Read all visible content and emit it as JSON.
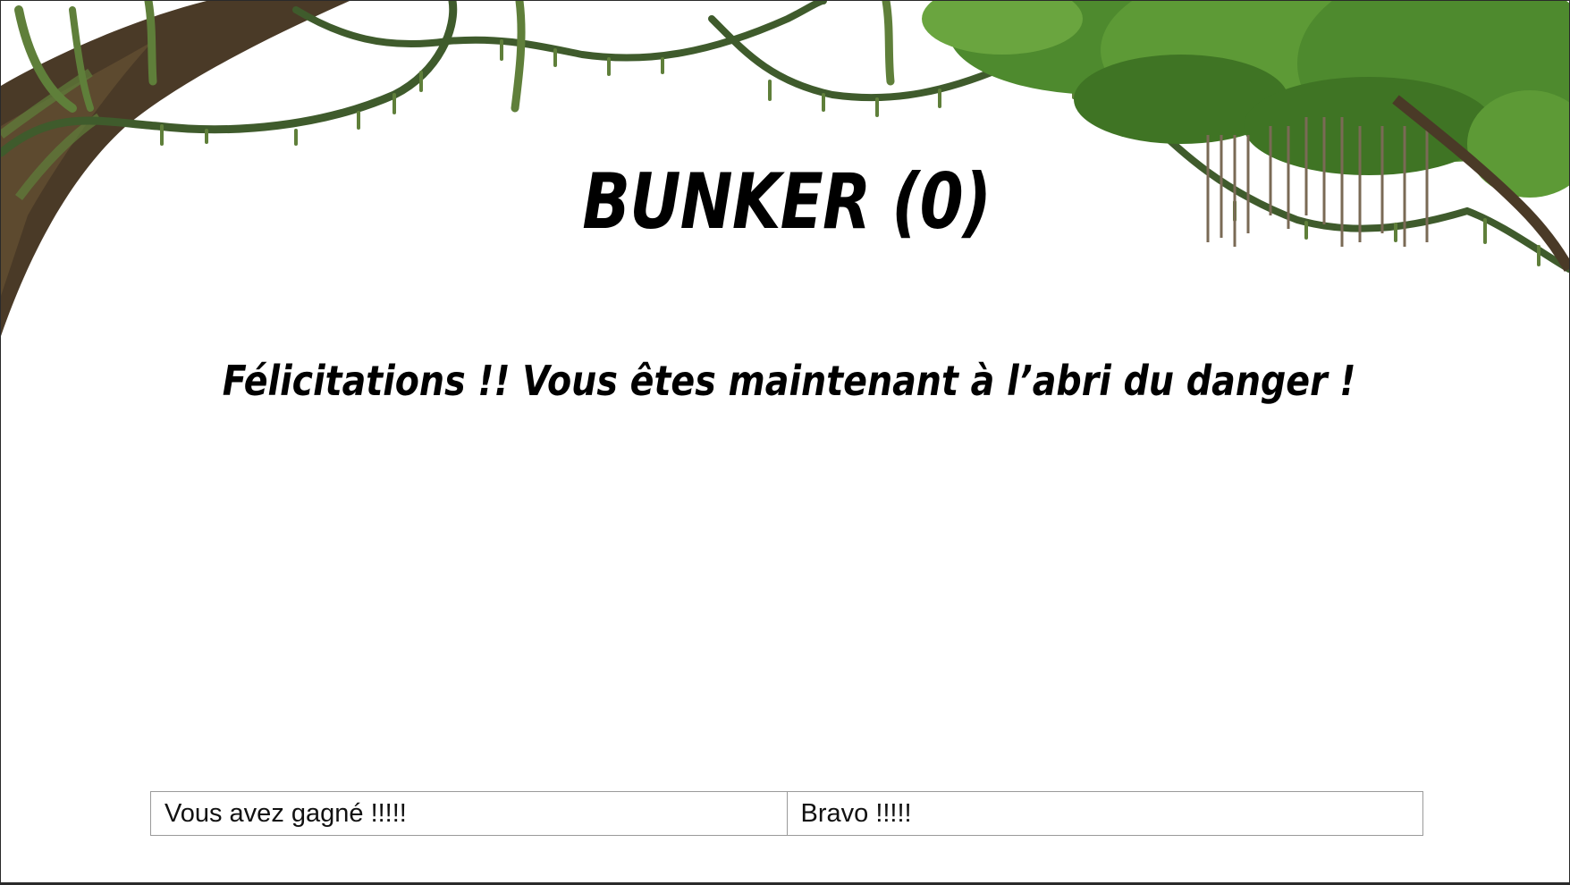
{
  "slide": {
    "title": "BUNKER (0)",
    "message": "Félicitations !! Vous êtes maintenant à l’abri du danger !"
  },
  "choices": [
    {
      "label": "Vous avez gagné !!!!!"
    },
    {
      "label": "Bravo !!!!!"
    }
  ],
  "colors": {
    "text": "#000000",
    "background": "#ffffff",
    "vine": "#3f5b2c",
    "moss": "#5f7f3a",
    "foliage": "#4e8a2e",
    "bark": "#4a3a27",
    "border": "#9a9a9a"
  },
  "icons": {
    "decoration": "jungle-vines-tree-decoration"
  }
}
